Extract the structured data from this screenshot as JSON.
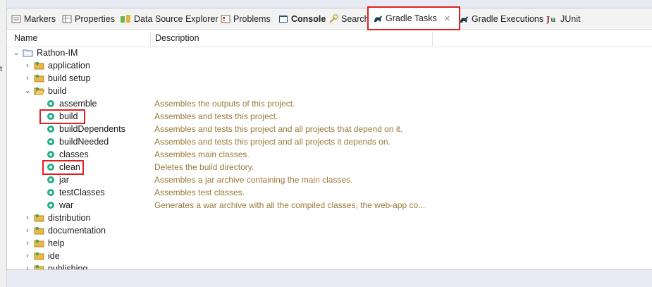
{
  "left_edge_glyph": "t",
  "tabs": [
    {
      "label": "Markers",
      "icon": "markers-icon",
      "active": false
    },
    {
      "label": "Properties",
      "icon": "properties-icon",
      "active": false
    },
    {
      "label": "Data Source Explorer",
      "icon": "data-source-icon",
      "active": false
    },
    {
      "label": "Problems",
      "icon": "problems-icon",
      "active": false
    },
    {
      "label": "Console",
      "icon": "console-icon",
      "active": false
    },
    {
      "label": "Search",
      "icon": "search-icon",
      "active": false
    },
    {
      "label": "Gradle Tasks",
      "icon": "gradle-icon",
      "active": true
    },
    {
      "label": "Gradle Executions",
      "icon": "gradle-icon",
      "active": false
    },
    {
      "label": "JUnit",
      "icon": "junit-icon",
      "active": false
    }
  ],
  "columns": {
    "name": "Name",
    "description": "Description"
  },
  "tree": {
    "project": "Rathon-IM",
    "groups": {
      "application": "application",
      "build_setup": "build setup",
      "build": "build",
      "distribution": "distribution",
      "documentation": "documentation",
      "help": "help",
      "ide": "ide",
      "publishing": "publishing"
    },
    "build_tasks": [
      {
        "name": "assemble",
        "description": "Assembles the outputs of this project."
      },
      {
        "name": "build",
        "description": "Assembles and tests this project."
      },
      {
        "name": "buildDependents",
        "description": "Assembles and tests this project and all projects that depend on it."
      },
      {
        "name": "buildNeeded",
        "description": "Assembles and tests this project and all projects it depends on."
      },
      {
        "name": "classes",
        "description": "Assembles main classes."
      },
      {
        "name": "clean",
        "description": "Deletes the build directory."
      },
      {
        "name": "jar",
        "description": "Assembles a jar archive containing the main classes."
      },
      {
        "name": "testClasses",
        "description": "Assembles test classes."
      },
      {
        "name": "war",
        "description": "Generates a war archive with all the compiled classes, the web-app co..."
      }
    ]
  },
  "colors": {
    "highlight": "#e02020",
    "description_text": "#9a7a3a",
    "task_icon": "#1fae8a",
    "folder": "#e8b84a"
  }
}
